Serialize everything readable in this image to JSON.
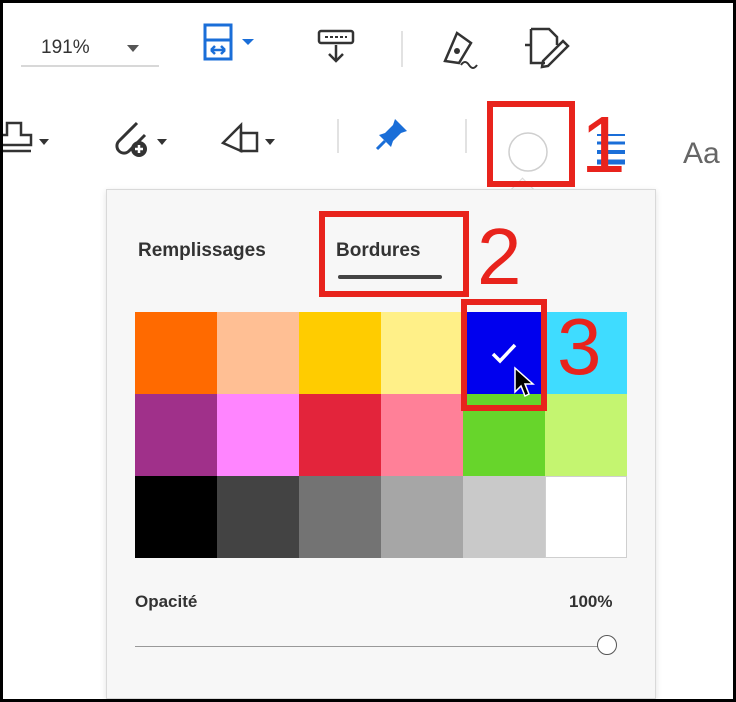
{
  "toolbar": {
    "zoom_value": "191%",
    "aa_label": "Aa"
  },
  "popup": {
    "tabs": [
      {
        "label": "Remplissages",
        "selected": false
      },
      {
        "label": "Bordures",
        "selected": true
      }
    ],
    "swatches": [
      {
        "color": "#ff6a00"
      },
      {
        "color": "#ffbf94"
      },
      {
        "color": "#ffcc00"
      },
      {
        "color": "#fff088"
      },
      {
        "color": "#0000ee",
        "selected": true
      },
      {
        "color": "#3fdcff"
      },
      {
        "color": "#a0308a"
      },
      {
        "color": "#ff85ff"
      },
      {
        "color": "#e3243b"
      },
      {
        "color": "#ff8098"
      },
      {
        "color": "#67d52b"
      },
      {
        "color": "#c4f570"
      },
      {
        "color": "#000000"
      },
      {
        "color": "#434343"
      },
      {
        "color": "#737373"
      },
      {
        "color": "#a6a6a6"
      },
      {
        "color": "#c9c9c9"
      },
      {
        "color": "#ffffff"
      }
    ],
    "opacity_label": "Opacité",
    "opacity_value": "100%",
    "opacity_fraction": 1.0
  },
  "annotations": {
    "step1": "1",
    "step2": "2",
    "step3": "3"
  },
  "colors": {
    "annotation_red": "#e8231c",
    "icon_blue": "#1a6ed8"
  }
}
